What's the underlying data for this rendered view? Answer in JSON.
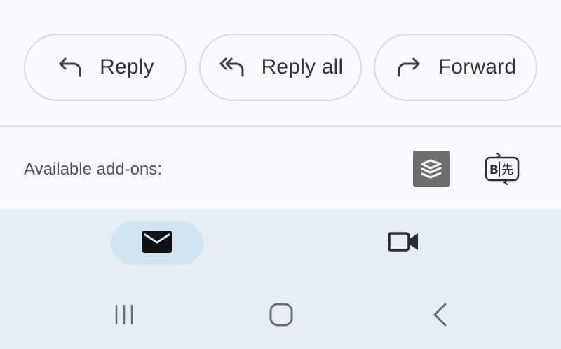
{
  "actions": {
    "reply_label": "Reply",
    "reply_all_label": "Reply all",
    "forward_label": "Forward"
  },
  "addons": {
    "label": "Available add-ons:",
    "items": [
      {
        "icon": "layers-addon-icon"
      },
      {
        "icon": "translate-addon-icon"
      }
    ]
  },
  "bottom_nav": {
    "items": [
      {
        "icon": "mail-icon",
        "selected": true
      },
      {
        "icon": "video-camera-icon",
        "selected": false
      }
    ]
  },
  "system_nav": {
    "items": [
      {
        "icon": "recents-icon"
      },
      {
        "icon": "home-icon"
      },
      {
        "icon": "back-icon"
      }
    ]
  },
  "colors": {
    "background": "#fafafe",
    "button_border": "#dadce3",
    "text_primary": "#333539",
    "nav_background": "#e6edf4",
    "nav_selected_pill": "#d2e3f2"
  }
}
